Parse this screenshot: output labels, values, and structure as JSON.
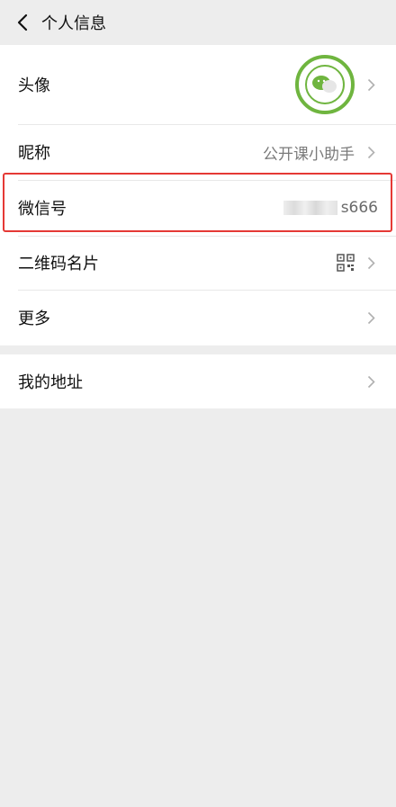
{
  "header": {
    "title": "个人信息"
  },
  "rows": {
    "avatar": {
      "label": "头像"
    },
    "nickname": {
      "label": "昵称",
      "value": "公开课小助手"
    },
    "wechat_id": {
      "label": "微信号",
      "value": "s666"
    },
    "qr_card": {
      "label": "二维码名片"
    },
    "more": {
      "label": "更多"
    },
    "address": {
      "label": "我的地址"
    }
  },
  "icons": {
    "back": "chevron-left-icon",
    "chevron": "chevron-right-icon",
    "qr": "qr-code-icon"
  },
  "colors": {
    "brand_green": "#6fb53f",
    "highlight_red": "#e53935",
    "background": "#ededed"
  }
}
